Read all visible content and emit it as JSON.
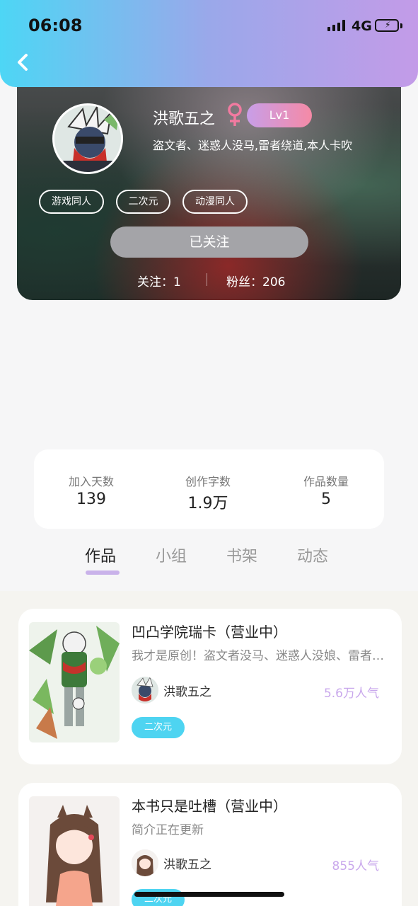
{
  "status_bar": {
    "time": "06:08",
    "network": "4G"
  },
  "profile": {
    "name": "洪歌五之",
    "level": "Lv1",
    "bio": "盗文者、迷惑人没马,雷者绕道,本人卡吹",
    "tags": [
      "游戏同人",
      "二次元",
      "动漫同人"
    ],
    "follow_button": "已关注",
    "following_label": "关注：",
    "following_count": "1",
    "fans_label": "粉丝：",
    "fans_count": "206"
  },
  "stats": [
    {
      "label": "加入天数",
      "value": "139"
    },
    {
      "label": "创作字数",
      "value": "1.9万"
    },
    {
      "label": "作品数量",
      "value": "5"
    }
  ],
  "tabs": [
    "作品",
    "小组",
    "书架",
    "动态"
  ],
  "active_tab": "作品",
  "books": [
    {
      "title": "凹凸学院瑞卡（营业中）",
      "description": "我才是原创！盗文者没马、迷惑人没娘、雷者绕道",
      "author": "洪歌五之",
      "popularity": "5.6万人气",
      "tag": "二次元"
    },
    {
      "title": "本书只是吐槽（营业中）",
      "description": "简介正在更新",
      "author": "洪歌五之",
      "popularity": "855人气",
      "tag": "二次元"
    }
  ],
  "colors": {
    "header_gradient_start": "#4dd6f5",
    "header_gradient_end": "#c39be8",
    "accent_purple": "#c9b2ea",
    "tag_cyan": "#4ed4f1",
    "popularity": "#c9a8ec",
    "gender_icon": "#f27aa0"
  },
  "icons": [
    "back-arrow-icon",
    "signal-icon",
    "battery-icon",
    "female-gender-icon"
  ]
}
